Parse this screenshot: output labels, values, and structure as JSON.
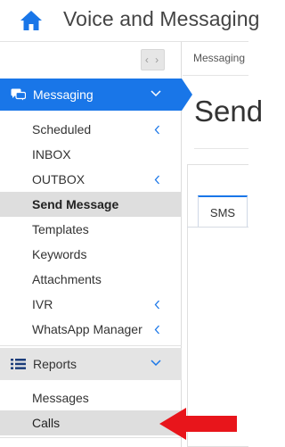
{
  "header": {
    "title": "Voice and Messaging"
  },
  "sidebar": {
    "collapse_label": "‹ ›",
    "messaging": {
      "label": "Messaging",
      "items": [
        {
          "label": "Scheduled",
          "has_chevron": true
        },
        {
          "label": "INBOX",
          "has_chevron": false
        },
        {
          "label": "OUTBOX",
          "has_chevron": true
        },
        {
          "label": "Send Message",
          "has_chevron": false,
          "selected": true
        },
        {
          "label": "Templates",
          "has_chevron": false
        },
        {
          "label": "Keywords",
          "has_chevron": false
        },
        {
          "label": "Attachments",
          "has_chevron": false
        },
        {
          "label": "IVR",
          "has_chevron": true
        },
        {
          "label": "WhatsApp Manager",
          "has_chevron": true
        }
      ]
    },
    "reports": {
      "label": "Reports",
      "items": [
        {
          "label": "Messages"
        },
        {
          "label": "Calls",
          "highlighted": true
        }
      ]
    }
  },
  "main": {
    "breadcrumb": "Messaging",
    "page_title": "Send",
    "tabs": [
      {
        "label": "SMS",
        "active": true
      }
    ]
  },
  "colors": {
    "accent": "#1976e8",
    "annotation_arrow": "#e8151b"
  },
  "icons": [
    "home-icon",
    "chat-bubbles-icon",
    "reports-list-icon",
    "chevron-down-icon",
    "chevron-left-icon",
    "red-arrow-annotation"
  ]
}
